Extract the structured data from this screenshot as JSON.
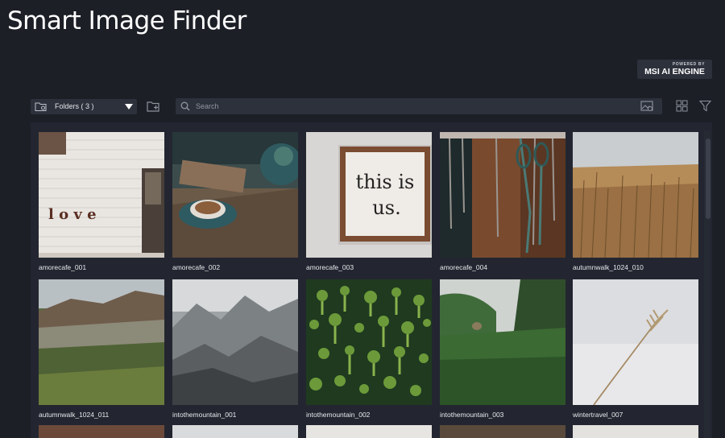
{
  "app": {
    "title": "Smart Image Finder"
  },
  "brand": {
    "top": "POWERED BY",
    "name": "MSI AI ENGINE"
  },
  "toolbar": {
    "folders_label": "Folders ( 3 )",
    "search_placeholder": "Search",
    "search_value": ""
  },
  "gallery": {
    "items": [
      {
        "name": "amorecafe_001",
        "overlay": "l o v e"
      },
      {
        "name": "amorecafe_002"
      },
      {
        "name": "amorecafe_003",
        "sign_line1": "this is",
        "sign_line2": "us."
      },
      {
        "name": "amorecafe_004"
      },
      {
        "name": "autumnwalk_1024_010"
      },
      {
        "name": "autumnwalk_1024_011"
      },
      {
        "name": "intothemountain_001"
      },
      {
        "name": "intothemountain_002"
      },
      {
        "name": "intothemountain_003"
      },
      {
        "name": "wintertravel_007"
      }
    ]
  },
  "colors": {
    "background": "#1c1f26",
    "panel": "#232630",
    "control": "#2d313b"
  }
}
